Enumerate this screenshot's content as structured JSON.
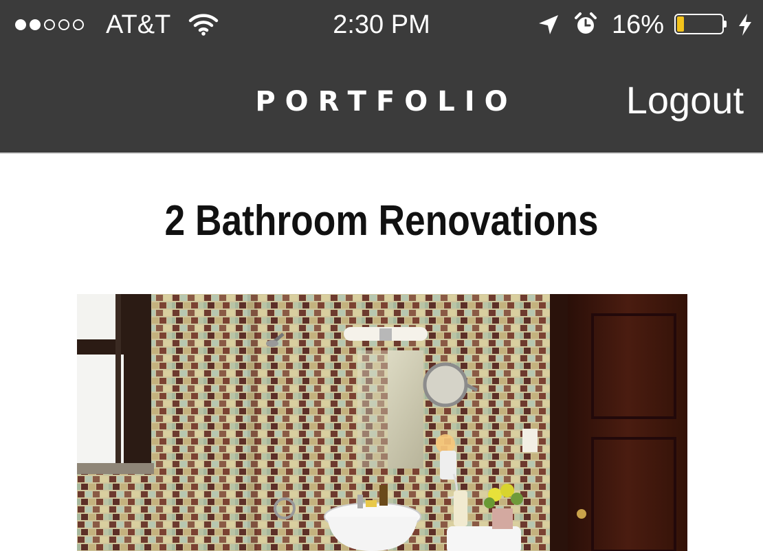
{
  "status_bar": {
    "signal_bars_filled": 2,
    "signal_bars_total": 5,
    "carrier": "AT&T",
    "time": "2:30 PM",
    "battery_percent_text": "16%",
    "battery_level": 0.16,
    "battery_color": "#f2c21b",
    "icons": [
      "wifi-icon",
      "location-arrow-icon",
      "alarm-clock-icon",
      "battery-icon",
      "charging-bolt-icon"
    ]
  },
  "nav": {
    "title": "PORTFOLIO",
    "logout_label": "Logout",
    "background": "#3b3b3b"
  },
  "content": {
    "heading": "2 Bathroom Renovations",
    "photo_subject": "bathroom with mosaic tile walls, pedestal sink, mirror, window and wooden door"
  }
}
